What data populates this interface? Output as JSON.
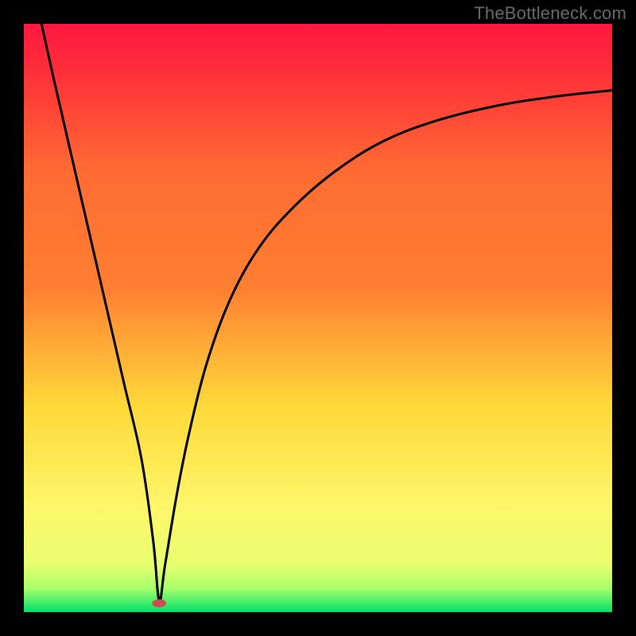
{
  "watermark": "TheBottleneck.com",
  "chart_data": {
    "type": "line",
    "title": "",
    "xlabel": "",
    "ylabel": "",
    "xlim": [
      0,
      100
    ],
    "ylim": [
      0,
      100
    ],
    "grid": false,
    "legend": false,
    "background_gradient": {
      "top": "#ff183f",
      "upper_mid": "#ff7f32",
      "mid": "#ffd93a",
      "lower_mid": "#fff66a",
      "bottom": "#00e06a"
    },
    "curve": {
      "description": "Bottleneck-style V curve with minimum near x≈23; steep linear-ish drop from top-left, then rises with decreasing slope toward upper-right",
      "x": [
        3,
        5,
        8,
        11,
        14,
        17,
        20,
        22,
        23,
        24,
        26,
        28,
        31,
        35,
        40,
        46,
        53,
        61,
        70,
        80,
        90,
        100
      ],
      "y": [
        100,
        91,
        78,
        65,
        52,
        39,
        26,
        12,
        2,
        8,
        20,
        30,
        42,
        53,
        62,
        69,
        75,
        80,
        83.5,
        86,
        87.6,
        88.7
      ]
    },
    "marker": {
      "x": 23,
      "y": 1.5,
      "color": "#c94f55",
      "rx": 9,
      "ry": 5
    }
  }
}
